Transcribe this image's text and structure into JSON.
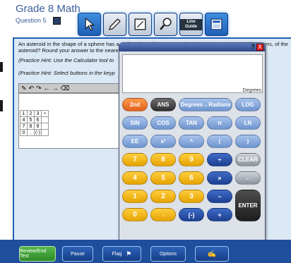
{
  "header": {
    "title": "Grade 8 Math",
    "question_label": "Question 5",
    "toolbar": [
      {
        "name": "pointer-tool-button",
        "icon": "pointer-icon"
      },
      {
        "name": "highlighter-tool-button",
        "icon": "highlighter-icon"
      },
      {
        "name": "notepad-tool-button",
        "icon": "notepad-icon"
      },
      {
        "name": "magnifier-tool-button",
        "icon": "magnifier-icon"
      },
      {
        "name": "line-guide-tool-button",
        "icon": "line-guide-icon",
        "label": "Line Guide"
      },
      {
        "name": "calculator-tool-button",
        "icon": "calculator-icon"
      }
    ]
  },
  "question": {
    "text": "An asteroid in the shape of a sphere has a radius of 2.4 kilometers. What is the volume, in cubic kilometers, of the asteroid? Round your answer to the nearest tenth.",
    "hint1": "(Practice Hint: Use the Calculator tool to",
    "hint2": "(Practice Hint: Select buttons in the keyp"
  },
  "keypad": [
    [
      "1",
      "2",
      "3",
      ""
    ],
    [
      "4",
      "5",
      "6",
      ""
    ],
    [
      "7",
      "8",
      "9",
      ""
    ],
    [
      "0",
      ".",
      "(-)",
      ""
    ]
  ],
  "calculator": {
    "help": "?",
    "close": "X",
    "mode": "Degrees",
    "buttons": [
      {
        "label": "2nd",
        "style": "k-orange",
        "name": "second-function-button"
      },
      {
        "label": "ANS",
        "style": "k-dark",
        "name": "ans-button"
      },
      {
        "label": "Degrees↔Radians",
        "style": "k-blue",
        "name": "degrees-radians-button"
      },
      {
        "label": "LOG",
        "style": "k-blue",
        "name": "log-button"
      },
      {
        "label": "SIN",
        "style": "k-blue",
        "name": "sin-button"
      },
      {
        "label": "COS",
        "style": "k-blue",
        "name": "cos-button"
      },
      {
        "label": "TAN",
        "style": "k-blue",
        "name": "tan-button"
      },
      {
        "label": "π",
        "style": "k-blue",
        "name": "pi-button"
      },
      {
        "label": "LN",
        "style": "k-blue",
        "name": "ln-button"
      },
      {
        "label": "EE",
        "style": "k-blue",
        "name": "ee-button"
      },
      {
        "label": "x²",
        "style": "k-blue",
        "name": "square-button"
      },
      {
        "label": "^",
        "style": "k-blue",
        "name": "power-button"
      },
      {
        "label": "(",
        "style": "k-blue",
        "name": "open-paren-button"
      },
      {
        "label": ")",
        "style": "k-blue",
        "name": "close-paren-button"
      },
      {
        "label": "7",
        "style": "k-yellow",
        "name": "digit-7-button"
      },
      {
        "label": "8",
        "style": "k-yellow",
        "name": "digit-8-button"
      },
      {
        "label": "9",
        "style": "k-yellow",
        "name": "digit-9-button"
      },
      {
        "label": "÷",
        "style": "k-navy",
        "name": "divide-button"
      },
      {
        "label": "CLEAR",
        "style": "k-gray",
        "name": "clear-button"
      },
      {
        "label": "4",
        "style": "k-yellow",
        "name": "digit-4-button"
      },
      {
        "label": "5",
        "style": "k-yellow",
        "name": "digit-5-button"
      },
      {
        "label": "6",
        "style": "k-yellow",
        "name": "digit-6-button"
      },
      {
        "label": "×",
        "style": "k-navy",
        "name": "multiply-button"
      },
      {
        "label": "←",
        "style": "k-gray",
        "name": "backspace-button"
      },
      {
        "label": "1",
        "style": "k-yellow",
        "name": "digit-1-button"
      },
      {
        "label": "2",
        "style": "k-yellow",
        "name": "digit-2-button"
      },
      {
        "label": "3",
        "style": "k-yellow",
        "name": "digit-3-button"
      },
      {
        "label": "−",
        "style": "k-navy",
        "name": "subtract-button"
      },
      {
        "label": "ENTER",
        "style": "k-enter",
        "name": "enter-button"
      },
      {
        "label": "0",
        "style": "k-yellow",
        "name": "digit-0-button"
      },
      {
        "label": ".",
        "style": "k-yellow",
        "name": "decimal-button"
      },
      {
        "label": "(-)",
        "style": "k-navy",
        "name": "negate-button"
      },
      {
        "label": "+",
        "style": "k-navy",
        "name": "add-button"
      }
    ]
  },
  "footer": {
    "review_label": "Review/End Test",
    "pause_label": "Pause",
    "flag_label": "Flag",
    "options_label": "Options",
    "last_icon": "accommodation-icon"
  }
}
